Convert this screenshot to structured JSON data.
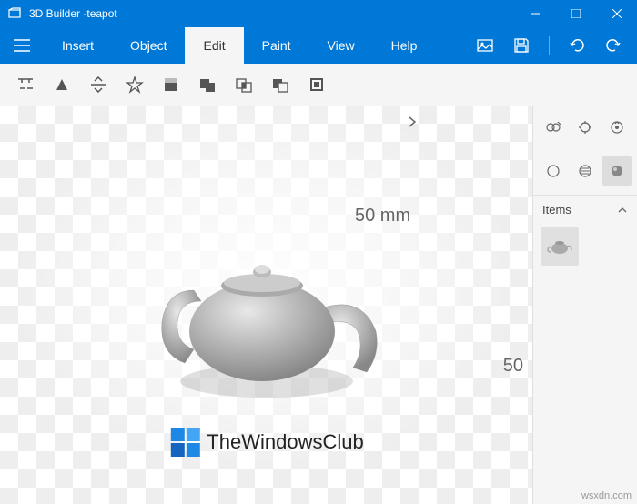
{
  "titlebar": {
    "app_name": "3D Builder",
    "document": "-teapot"
  },
  "menu": {
    "items": [
      {
        "label": "Insert"
      },
      {
        "label": "Object"
      },
      {
        "label": "Edit"
      },
      {
        "label": "Paint"
      },
      {
        "label": "View"
      },
      {
        "label": "Help"
      }
    ],
    "active_index": 2
  },
  "viewport": {
    "dimension_top": "50 mm",
    "dimension_right": "50"
  },
  "sidebar": {
    "items_header": "Items"
  },
  "watermark": {
    "text": "TheWindowsClub"
  },
  "footer": {
    "tag": "wsxdn.com"
  }
}
